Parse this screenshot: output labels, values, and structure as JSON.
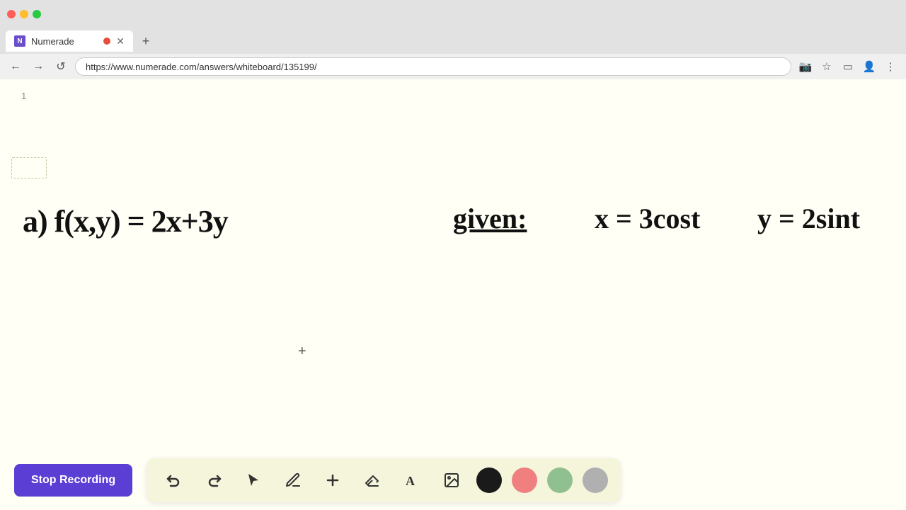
{
  "browser": {
    "tab_title": "Numerade",
    "url": "https://www.numerade.com/answers/whiteboard/135199/",
    "recording_dot_color": "#e74c3c",
    "nav": {
      "back_label": "←",
      "forward_label": "→",
      "reload_label": "↺"
    }
  },
  "whiteboard": {
    "page_number": "1",
    "formula_left": "a) f(x,y) = 2x+3y",
    "given_label": "given:",
    "formula_x": "x = 3cost",
    "formula_y": "y = 2sint",
    "cursor": "+"
  },
  "toolbar": {
    "stop_recording_label": "Stop Recording",
    "tools": [
      {
        "id": "undo",
        "label": "↩",
        "name": "undo"
      },
      {
        "id": "redo",
        "label": "↪",
        "name": "redo"
      },
      {
        "id": "select",
        "label": "▲",
        "name": "select"
      },
      {
        "id": "pen",
        "label": "✏",
        "name": "pen"
      },
      {
        "id": "add",
        "label": "+",
        "name": "add-element"
      },
      {
        "id": "eraser",
        "label": "✂",
        "name": "eraser"
      },
      {
        "id": "text",
        "label": "A",
        "name": "text"
      },
      {
        "id": "image",
        "label": "🖼",
        "name": "image"
      }
    ],
    "colors": [
      {
        "id": "black",
        "hex": "#1a1a1a",
        "name": "black"
      },
      {
        "id": "pink",
        "hex": "#f08080",
        "name": "pink"
      },
      {
        "id": "green",
        "hex": "#90c090",
        "name": "green"
      },
      {
        "id": "gray",
        "hex": "#b0b0b0",
        "name": "gray"
      }
    ]
  }
}
